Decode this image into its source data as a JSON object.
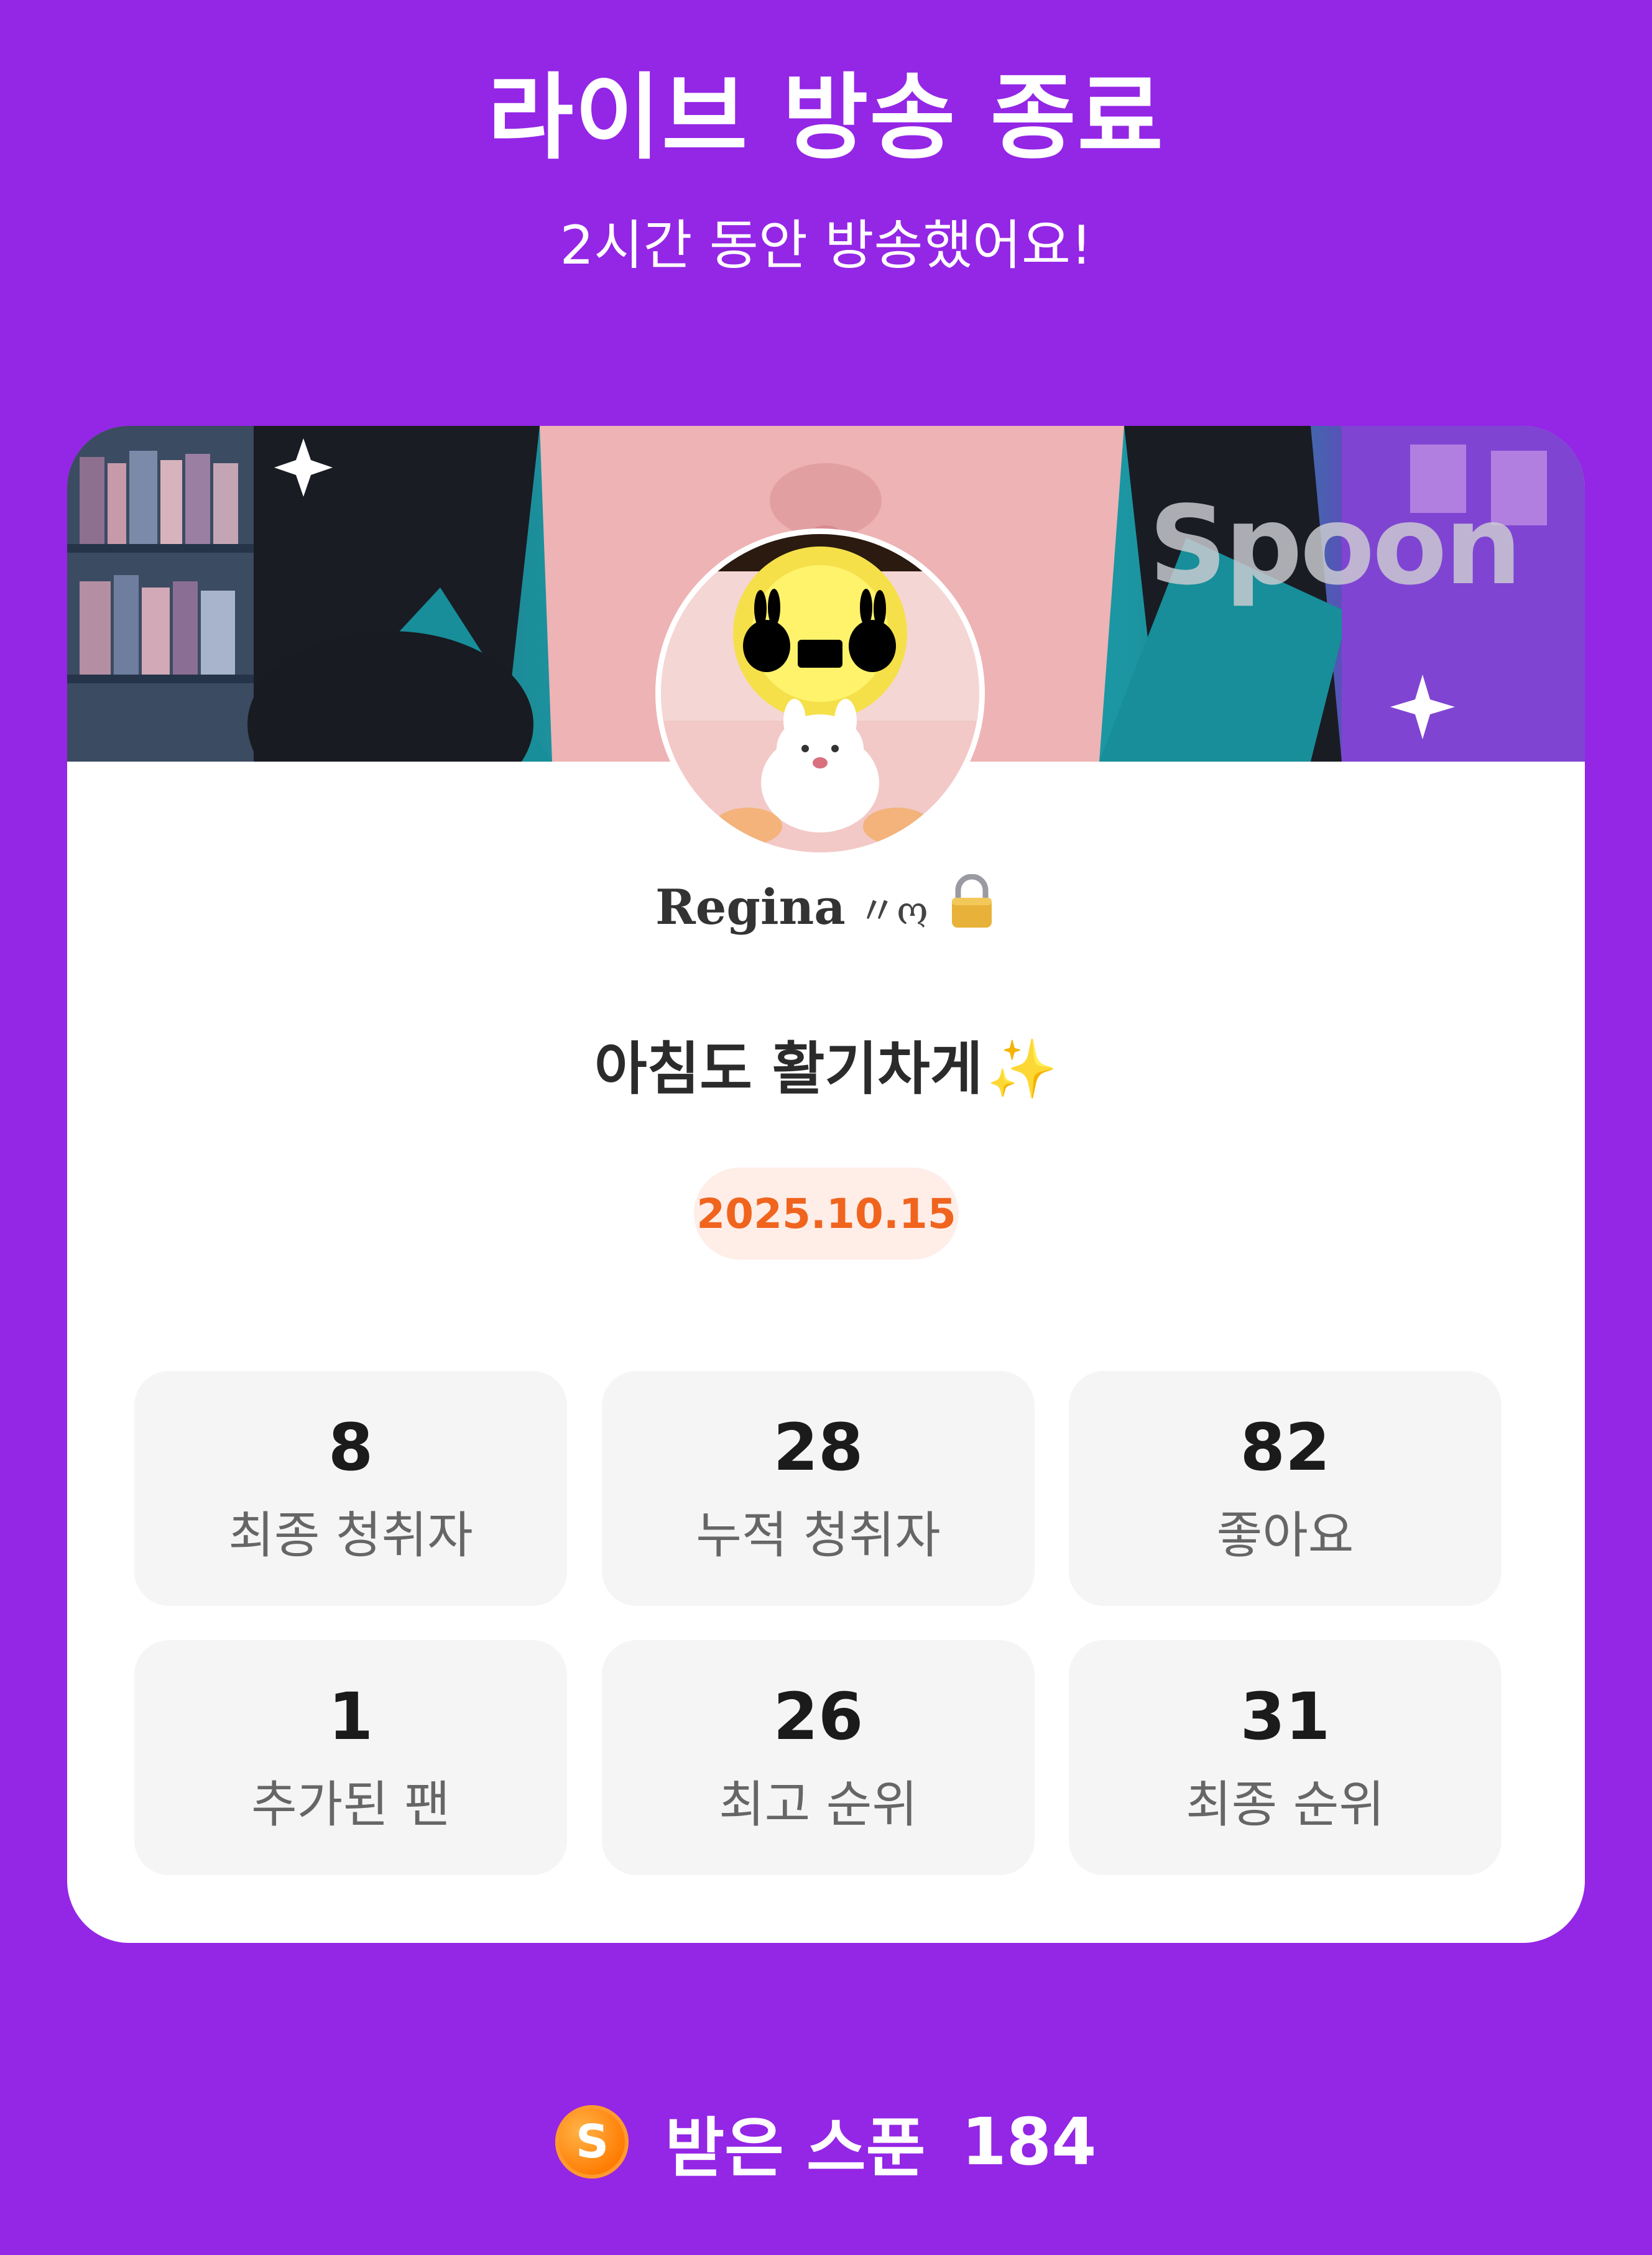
{
  "header": {
    "title": "라이브 방송 종료",
    "subtitle": "2시간 동안 방송했어요!"
  },
  "banner": {
    "watermark": "Spoon"
  },
  "profile": {
    "name": "Regina",
    "name_decoration": "〃ო",
    "lock_icon": "lock-icon"
  },
  "live": {
    "title": "아침도 활기차게",
    "title_emoji": "✨",
    "date": "2025.10.15"
  },
  "stats": [
    {
      "value": "8",
      "label": "최종 청취자"
    },
    {
      "value": "28",
      "label": "누적 청취자"
    },
    {
      "value": "82",
      "label": "좋아요"
    },
    {
      "value": "1",
      "label": "추가된 팬"
    },
    {
      "value": "26",
      "label": "최고 순위"
    },
    {
      "value": "31",
      "label": "최종 순위"
    }
  ],
  "spoons": {
    "icon_letter": "S",
    "label": "받은 스푼",
    "count": "184"
  },
  "colors": {
    "background": "#9426E6",
    "date_text": "#F0641E",
    "date_bg": "#FFEDE8",
    "coin": "#FF7A00"
  }
}
